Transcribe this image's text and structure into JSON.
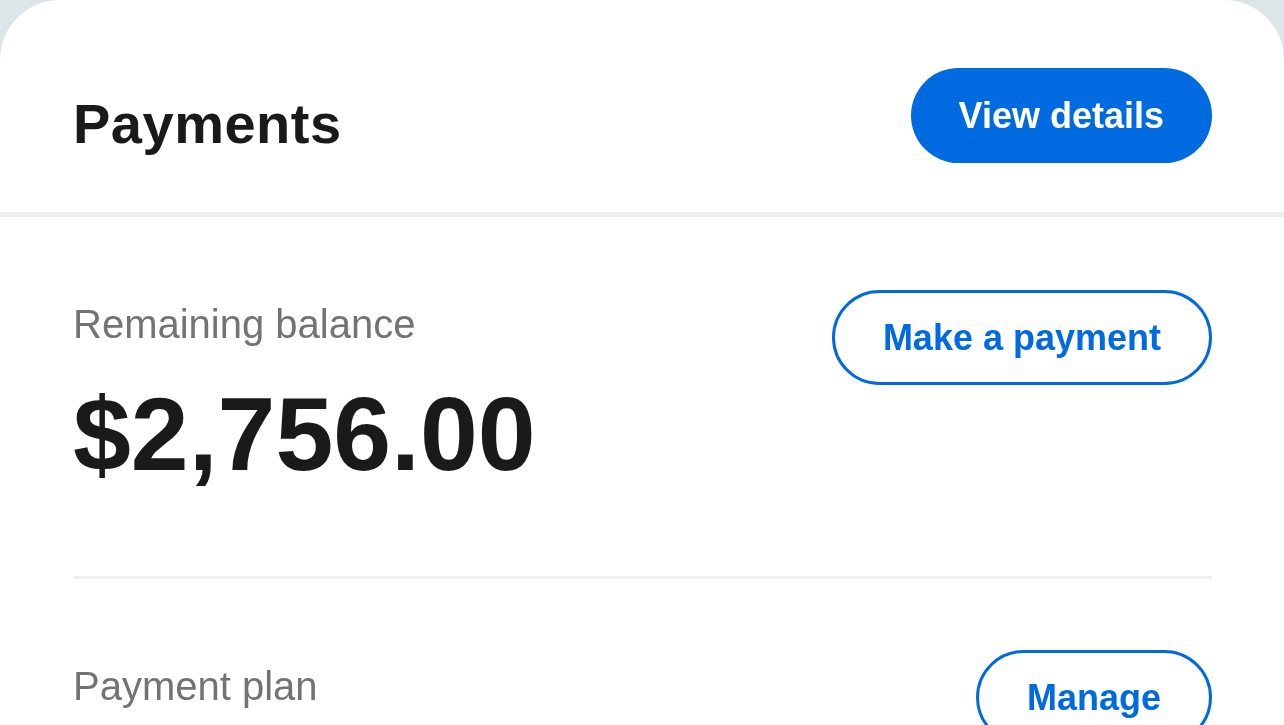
{
  "header": {
    "title": "Payments",
    "action": "View details"
  },
  "sections": [
    {
      "label": "Remaining balance",
      "value": "$2,756.00",
      "action": "Make a payment"
    },
    {
      "label": "Payment plan",
      "action": "Manage"
    }
  ]
}
